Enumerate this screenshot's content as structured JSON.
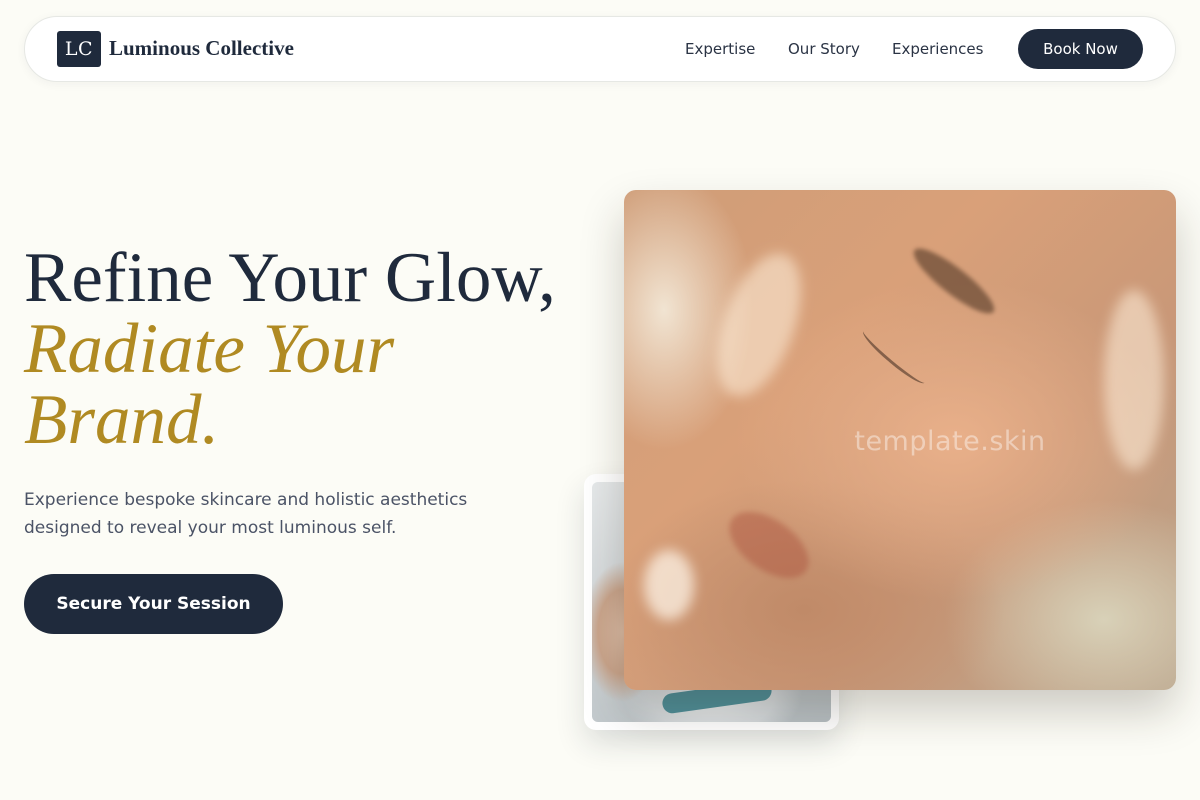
{
  "header": {
    "logo_mark": "LC",
    "brand_name": "Luminous Collective",
    "nav": [
      {
        "label": "Expertise"
      },
      {
        "label": "Our Story"
      },
      {
        "label": "Experiences"
      }
    ],
    "book_label": "Book Now"
  },
  "hero": {
    "headline_line1": "Refine Your Glow,",
    "headline_accent": "Radiate Your Brand.",
    "subtext": "Experience bespoke skincare and holistic aesthetics designed to reveal your most luminous self.",
    "cta_label": "Secure Your Session"
  },
  "images": {
    "main_watermark": "template.skin"
  },
  "colors": {
    "background": "#fcfcf6",
    "navy": "#1f2a3c",
    "gold_accent": "#b08a22",
    "body_text": "#4b5366"
  }
}
